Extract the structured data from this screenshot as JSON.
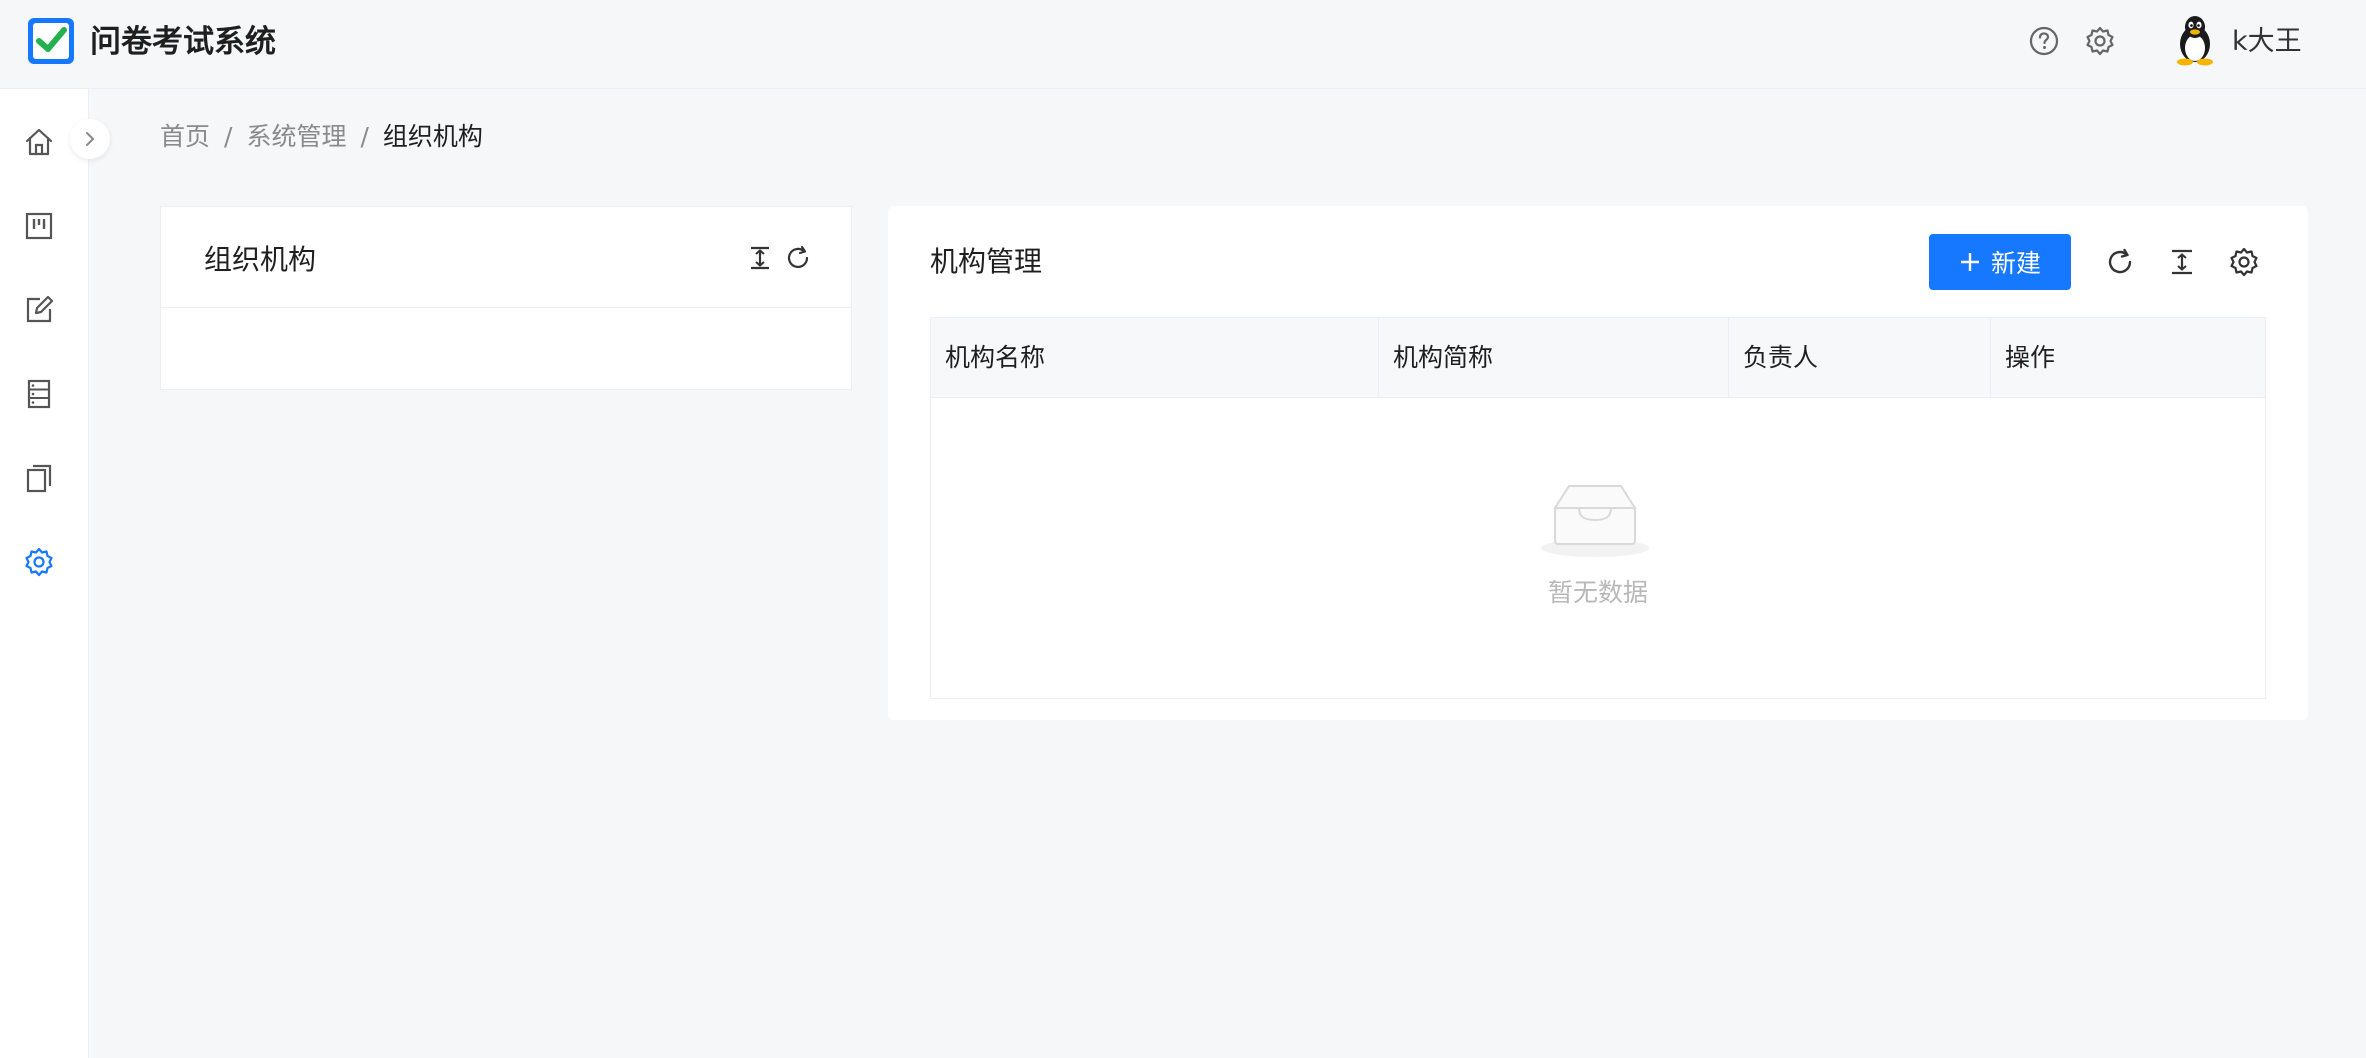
{
  "header": {
    "app_title": "问卷考试系统",
    "username": "k大王",
    "icons": [
      "help-icon",
      "settings-icon"
    ]
  },
  "sidebar": {
    "items": [
      {
        "icon": "home-icon",
        "active": false
      },
      {
        "icon": "board-icon",
        "active": false
      },
      {
        "icon": "edit-icon",
        "active": false
      },
      {
        "icon": "server-icon",
        "active": false
      },
      {
        "icon": "copy-icon",
        "active": false
      },
      {
        "icon": "settings-icon",
        "active": true
      }
    ],
    "accent_color": "#1677ff"
  },
  "breadcrumb": {
    "items": [
      "首页",
      "系统管理",
      "组织机构"
    ],
    "separator": "/"
  },
  "left_panel": {
    "title": "组织机构",
    "icons": [
      "expand-collapse-icon",
      "refresh-icon"
    ]
  },
  "right_panel": {
    "title": "机构管理",
    "new_button_label": "新建",
    "toolbar_icons": [
      "refresh-icon",
      "column-height-icon",
      "settings-icon"
    ],
    "table": {
      "columns": [
        "机构名称",
        "机构简称",
        "负责人",
        "操作"
      ],
      "rows": [],
      "empty_text": "暂无数据"
    }
  }
}
